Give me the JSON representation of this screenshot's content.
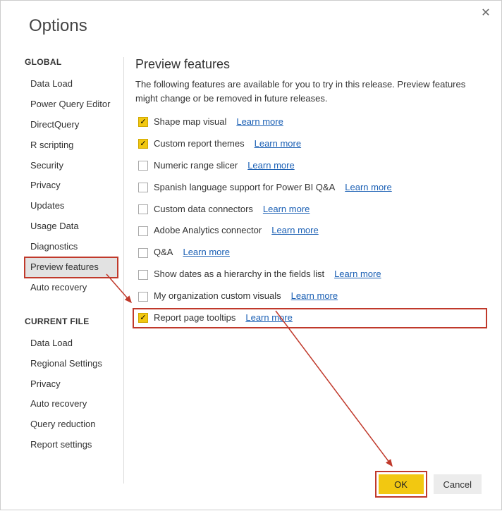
{
  "dialog": {
    "title": "Options"
  },
  "sidebar": {
    "sections": [
      {
        "header": "GLOBAL",
        "items": [
          {
            "label": "Data Load",
            "selected": false
          },
          {
            "label": "Power Query Editor",
            "selected": false
          },
          {
            "label": "DirectQuery",
            "selected": false
          },
          {
            "label": "R scripting",
            "selected": false
          },
          {
            "label": "Security",
            "selected": false
          },
          {
            "label": "Privacy",
            "selected": false
          },
          {
            "label": "Updates",
            "selected": false
          },
          {
            "label": "Usage Data",
            "selected": false
          },
          {
            "label": "Diagnostics",
            "selected": false
          },
          {
            "label": "Preview features",
            "selected": true
          },
          {
            "label": "Auto recovery",
            "selected": false
          }
        ]
      },
      {
        "header": "CURRENT FILE",
        "items": [
          {
            "label": "Data Load",
            "selected": false
          },
          {
            "label": "Regional Settings",
            "selected": false
          },
          {
            "label": "Privacy",
            "selected": false
          },
          {
            "label": "Auto recovery",
            "selected": false
          },
          {
            "label": "Query reduction",
            "selected": false
          },
          {
            "label": "Report settings",
            "selected": false
          }
        ]
      }
    ]
  },
  "main": {
    "title": "Preview features",
    "description": "The following features are available for you to try in this release. Preview features might change or be removed in future releases.",
    "learn_label": "Learn more",
    "features": [
      {
        "label": "Shape map visual",
        "checked": true,
        "highlighted": false
      },
      {
        "label": "Custom report themes",
        "checked": true,
        "highlighted": false
      },
      {
        "label": "Numeric range slicer",
        "checked": false,
        "highlighted": false
      },
      {
        "label": "Spanish language support for Power BI Q&A",
        "checked": false,
        "highlighted": false
      },
      {
        "label": "Custom data connectors",
        "checked": false,
        "highlighted": false
      },
      {
        "label": "Adobe Analytics connector",
        "checked": false,
        "highlighted": false
      },
      {
        "label": "Q&A",
        "checked": false,
        "highlighted": false
      },
      {
        "label": "Show dates as a hierarchy in the fields list",
        "checked": false,
        "highlighted": false
      },
      {
        "label": "My organization custom visuals",
        "checked": false,
        "highlighted": false
      },
      {
        "label": "Report page tooltips",
        "checked": true,
        "highlighted": true
      }
    ]
  },
  "footer": {
    "ok_label": "OK",
    "cancel_label": "Cancel"
  }
}
